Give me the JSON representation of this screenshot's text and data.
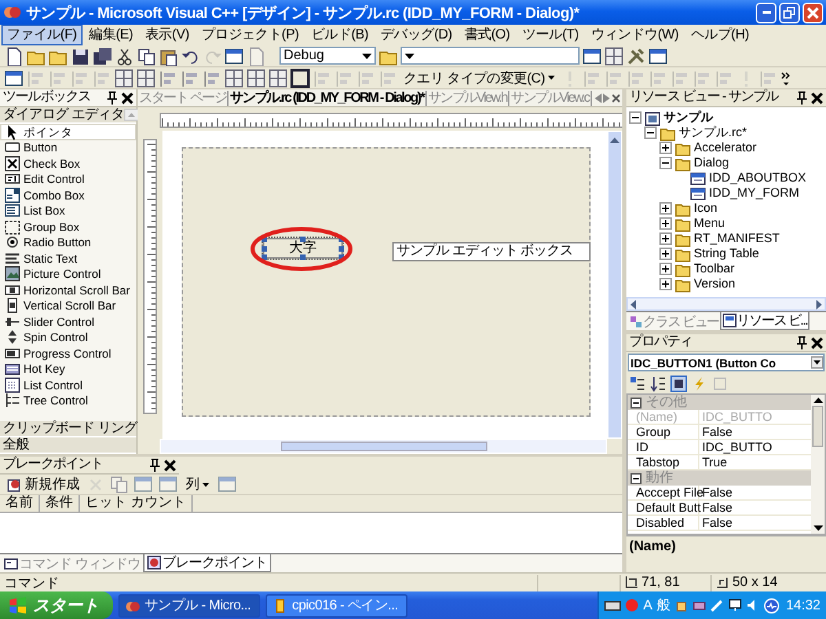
{
  "window": {
    "title": "サンプル - Microsoft Visual C++ [デザイン] - サンプル.rc (IDD_MY_FORM - Dialog)*"
  },
  "menu": [
    {
      "label": "ファイル(F)",
      "selected": true
    },
    {
      "label": "編集(E)",
      "selected": false
    },
    {
      "label": "表示(V)",
      "selected": false
    },
    {
      "label": "プロジェクト(P)",
      "selected": false
    },
    {
      "label": "ビルド(B)",
      "selected": false
    },
    {
      "label": "デバッグ(D)",
      "selected": false
    },
    {
      "label": "書式(O)",
      "selected": false
    },
    {
      "label": "ツール(T)",
      "selected": false
    },
    {
      "label": "ウィンドウ(W)",
      "selected": false
    },
    {
      "label": "ヘルプ(H)",
      "selected": false
    }
  ],
  "toolbar": {
    "configuration": "Debug",
    "query_button": "クエリ タイプの変更(C)"
  },
  "toolbox": {
    "title": "ツールボックス",
    "section": "ダイアログ エディタ",
    "items": [
      {
        "label": "ポインタ",
        "selected": true
      },
      {
        "label": "Button",
        "selected": false
      },
      {
        "label": "Check Box",
        "selected": false
      },
      {
        "label": "Edit Control",
        "selected": false
      },
      {
        "label": "Combo Box",
        "selected": false
      },
      {
        "label": "List Box",
        "selected": false
      },
      {
        "label": "Group Box",
        "selected": false
      },
      {
        "label": "Radio Button",
        "selected": false
      },
      {
        "label": "Static Text",
        "selected": false
      },
      {
        "label": "Picture Control",
        "selected": false
      },
      {
        "label": "Horizontal Scroll Bar",
        "selected": false
      },
      {
        "label": "Vertical Scroll Bar",
        "selected": false
      },
      {
        "label": "Slider Control",
        "selected": false
      },
      {
        "label": "Spin Control",
        "selected": false
      },
      {
        "label": "Progress Control",
        "selected": false
      },
      {
        "label": "Hot Key",
        "selected": false
      },
      {
        "label": "List Control",
        "selected": false
      },
      {
        "label": "Tree Control",
        "selected": false
      }
    ],
    "groups": [
      "クリップボード リング",
      "全般"
    ]
  },
  "editor": {
    "tabs": [
      {
        "label": "スタート ページ",
        "selected": false
      },
      {
        "label": "サンプル.rc (IDD_MY_FORM - Dialog)*",
        "selected": true
      },
      {
        "label": "サンプルView.h",
        "selected": false
      },
      {
        "label": "サンプルView.c",
        "selected": false
      }
    ],
    "controls": [
      {
        "kind": "button",
        "text": "大字",
        "selected": true,
        "annotated": true
      },
      {
        "kind": "edit",
        "text": "サンプル エディット ボックス",
        "selected": false,
        "annotated": false
      }
    ]
  },
  "breakpoints": {
    "title": "ブレークポイント",
    "new_button": "新規作成",
    "columns_button": "列",
    "columns": [
      "名前",
      "条件",
      "ヒット カウント"
    ]
  },
  "bottom_tabs": [
    {
      "label": "コマンド ウィンドウ",
      "selected": false
    },
    {
      "label": "ブレークポイント",
      "selected": true
    }
  ],
  "resource_view": {
    "title": "リソース ビュー - サンプル",
    "tree": [
      {
        "label": "サンプル",
        "kind": "project",
        "expanded": true,
        "children": [
          {
            "label": "サンプル.rc*",
            "kind": "folder",
            "expanded": true,
            "children": [
              {
                "label": "Accelerator",
                "kind": "folder",
                "expanded": false
              },
              {
                "label": "Dialog",
                "kind": "folder",
                "expanded": true,
                "children": [
                  {
                    "label": "IDD_ABOUTBOX",
                    "kind": "dialog"
                  },
                  {
                    "label": "IDD_MY_FORM",
                    "kind": "dialog"
                  }
                ]
              },
              {
                "label": "Icon",
                "kind": "folder",
                "expanded": false
              },
              {
                "label": "Menu",
                "kind": "folder",
                "expanded": false
              },
              {
                "label": "RT_MANIFEST",
                "kind": "folder",
                "expanded": false
              },
              {
                "label": "String Table",
                "kind": "folder",
                "expanded": false
              },
              {
                "label": "Toolbar",
                "kind": "folder",
                "expanded": false
              },
              {
                "label": "Version",
                "kind": "folder",
                "expanded": false
              }
            ]
          }
        ]
      }
    ],
    "tabs": [
      {
        "label": "クラス ビュー",
        "selected": false
      },
      {
        "label": "リソース ビ...",
        "selected": true
      }
    ]
  },
  "properties": {
    "title": "プロパティ",
    "object": "IDC_BUTTON1 (Button Co",
    "groups": [
      {
        "label": "その他",
        "rows": [
          {
            "name": "(Name)",
            "value": "IDC_BUTTO",
            "disabled": true
          },
          {
            "name": "Group",
            "value": "False",
            "disabled": false
          },
          {
            "name": "ID",
            "value": "IDC_BUTTO",
            "disabled": false
          },
          {
            "name": "Tabstop",
            "value": "True",
            "disabled": false
          }
        ]
      },
      {
        "label": "動作",
        "rows": [
          {
            "name": "Acccept File",
            "value": "False",
            "disabled": false
          },
          {
            "name": "Default Butt",
            "value": "False",
            "disabled": false
          },
          {
            "name": "Disabled",
            "value": "False",
            "disabled": false
          }
        ]
      }
    ],
    "description": "(Name)"
  },
  "status_bar": {
    "message": "コマンド",
    "position": "71, 81",
    "size": "50 x 14"
  },
  "taskbar": {
    "start": "スタート",
    "tasks": [
      {
        "label": "サンプル - Micro...",
        "selected": true
      },
      {
        "label": "cpic016 - ペイン...",
        "selected": false
      }
    ],
    "ime": [
      "A",
      "般"
    ],
    "clock": "14:32"
  }
}
